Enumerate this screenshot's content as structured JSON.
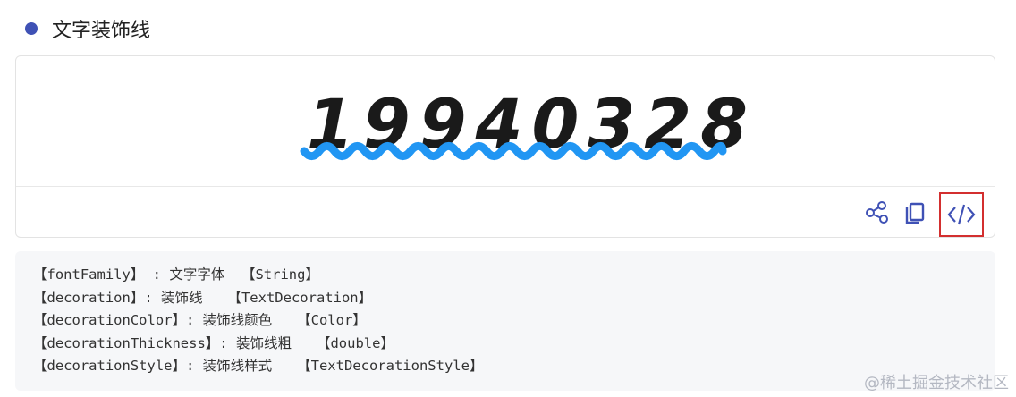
{
  "section": {
    "title": "文字装饰线",
    "accent_color": "#3f51b5"
  },
  "demo": {
    "text": "19940328",
    "decoration": "wavy underline",
    "decoration_color": "#2196f3",
    "text_color": "#1a1a1a"
  },
  "toolbar": {
    "icons": [
      "share-icon",
      "copy-icon",
      "code-icon"
    ],
    "icon_color": "#3f51b5",
    "highlight_color": "#d32f2f"
  },
  "properties": [
    "【fontFamily】 : 文字字体  【String】",
    "【decoration】: 装饰线   【TextDecoration】",
    "【decorationColor】: 装饰线颜色   【Color】",
    "【decorationThickness】: 装饰线粗   【double】",
    "【decorationStyle】: 装饰线样式   【TextDecorationStyle】"
  ],
  "watermark": "@稀土掘金技术社区"
}
